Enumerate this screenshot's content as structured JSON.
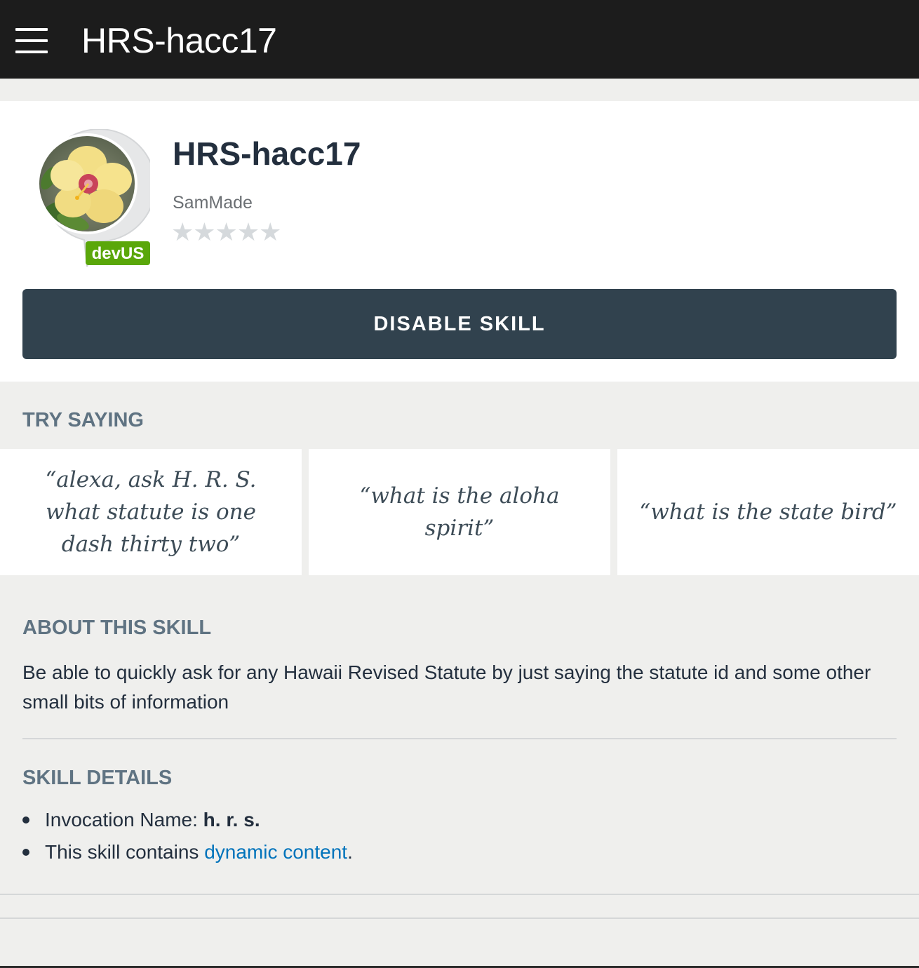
{
  "topbar": {
    "title": "HRS-hacc17",
    "menu_icon": "hamburger-menu-icon"
  },
  "skill": {
    "name": "HRS-hacc17",
    "developer": "SamMade",
    "badge": "devUS",
    "rating_stars": "★★★★★",
    "rating": 0,
    "rating_max": 5,
    "icon": "hibiscus-flower-icon",
    "disable_label": "DISABLE SKILL"
  },
  "try_saying": {
    "heading": "TRY SAYING",
    "utterances": [
      "“alexa, ask H. R. S. what statute is one dash thirty two”",
      "“what is the aloha spirit”",
      "“what is the state bird”"
    ]
  },
  "about": {
    "heading": "ABOUT THIS SKILL",
    "description": "Be able to quickly ask for any Hawaii Revised Statute by just saying the statute id and some other small bits of information"
  },
  "details": {
    "heading": "SKILL DETAILS",
    "invocation_label": "Invocation Name: ",
    "invocation_value": "h. r. s.",
    "dynamic_prefix": "This skill contains ",
    "dynamic_link": "dynamic content",
    "dynamic_suffix": "."
  },
  "colors": {
    "topbar": "#1c1c1c",
    "button": "#31424e",
    "badge": "#5aa70a",
    "link": "#0073bb",
    "heading": "#5f7382"
  }
}
